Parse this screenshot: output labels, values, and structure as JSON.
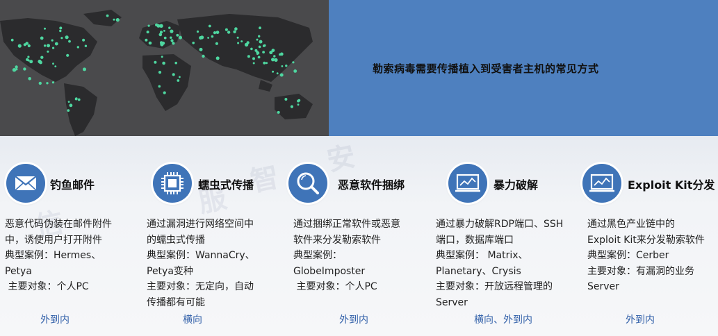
{
  "header": {
    "title": "勒索病毒需要传播植入到受害者主机的常见方式"
  },
  "colors": {
    "panel_blue": "#4e80bf",
    "icon_blue": "#3f74b8",
    "direction_text": "#2f5ea8",
    "map_dot": "#4ed7a0"
  },
  "watermark": [
    "信",
    "服",
    "智",
    "安"
  ],
  "columns": [
    {
      "icon": "envelope-icon",
      "title": "钓鱼邮件",
      "lines": [
        "恶意代码伪装在邮件附件",
        "中，诱使用户打开附件",
        "典型案例：Hermes、",
        "Petya",
        " 主要对象：个人PC"
      ],
      "direction": "外到内"
    },
    {
      "icon": "chip-icon",
      "title": "蠕虫式传播",
      "lines": [
        "通过漏洞进行网络空间中",
        "的蠕虫式传播",
        "典型案例：WannaCry、",
        "Petya变种",
        "主要对象：无定向，自动",
        "传播都有可能"
      ],
      "direction": "横向"
    },
    {
      "icon": "magnifier-icon",
      "title": "恶意软件捆绑",
      "lines": [
        "通过捆绑正常软件或恶意",
        "软件来分发勒索软件",
        "典型案例：",
        "GlobeImposter",
        " 主要对象：个人PC"
      ],
      "direction": "外到内"
    },
    {
      "icon": "monitor-chart-icon",
      "title": "暴力破解",
      "lines": [
        "通过暴力破解RDP端口、SSH",
        "端口，数据库端口",
        "典型案例： Matrix、",
        "Planetary、Crysis",
        "主要对象：开放远程管理的",
        "Server"
      ],
      "direction": "横向、外到内"
    },
    {
      "icon": "monitor-chart-icon",
      "title": "Exploit Kit分发",
      "lines": [
        "通过黑色产业链中的",
        "Exploit Kit来分发勒索软件",
        "典型案例：Cerber",
        "主要对象：有漏洞的业务",
        "Server"
      ],
      "direction": "外到内"
    }
  ]
}
